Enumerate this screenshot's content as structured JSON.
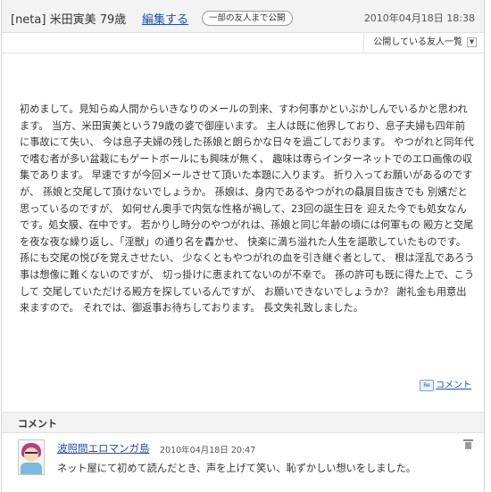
{
  "post": {
    "title": "[neta] 米田寅美 79歳",
    "edit_label": "編集する",
    "visibility_badge": "一部の友人まで公開",
    "date": "2010年04月18日 18:38",
    "visibility_button": "公開している友人一覧",
    "visibility_arrow": "▼",
    "body": "初めまして。見知らぬ人間からいきなりのメールの到来、すわ何事かといぶかしんでいるかと思われます。 当方、米田寅美という79歳の婆で御座います。 主人は既に他界しており、息子夫婦も四年前に事故にて失い、 今は息子夫婦の残した孫娘と朗らかな日々を過ごしております。 やつがれと同年代で嗜む者が多い盆栽にもゲートボールにも興味が無く、 趣味は専らインターネットでのエロ画像の収集であります。 早速ですが今回メールさせて頂いた本題に入ります。 折り入ってお願いがあるのですが、 孫娘と交尾して頂けないでしょうか。 孫娘は、身内であるやつがれの贔屓目抜きでも 別嬪だと思っているのですが、 如何せん奥手で内気な性格が禍して、23回の誕生日を 迎えた今でも処女なんです。処女膜、在中です。 若かりし時分のやつがれは、孫娘と同じ年齢の頃には何軍もの 殿方と交尾を夜な夜な繰り返し、「淫獣」の通り名を轟かせ、 快楽に満ち溢れた人生を謳歌していたものです。 孫にも交尾の悦びを覚えさせたい、 少なくともやつがれの血を引き継ぐ者として、 根は淫乱であろう事は想像に難くないのですが、 切っ掛けに恵まれてないのが不幸で。 孫の許可も既に得た上で、こうして 交尾していただける殿方を探しているんですが、 お願いできないでしょうか？ 謝礼金も用意出来ますので。 それでは、御返事お待ちしております。 長文失礼致しました。",
    "comment_link_icon": "Re",
    "comment_link_label": "コメント"
  },
  "comments": {
    "title": "コメント",
    "items": [
      {
        "author": "波照間エロマンガ島",
        "date": "2010年04月18日 20:47",
        "text": "ネット屋にて初めて読んだとき、声を上げて笑い、恥ずかしい想いをしました。",
        "avatar": "avatar-image",
        "delete_icon": "trash-icon"
      }
    ]
  },
  "colors": {
    "link": "#1f4fa8",
    "header_bg": "#f3f3f3",
    "border": "#e2e2e2",
    "text": "#333333"
  }
}
